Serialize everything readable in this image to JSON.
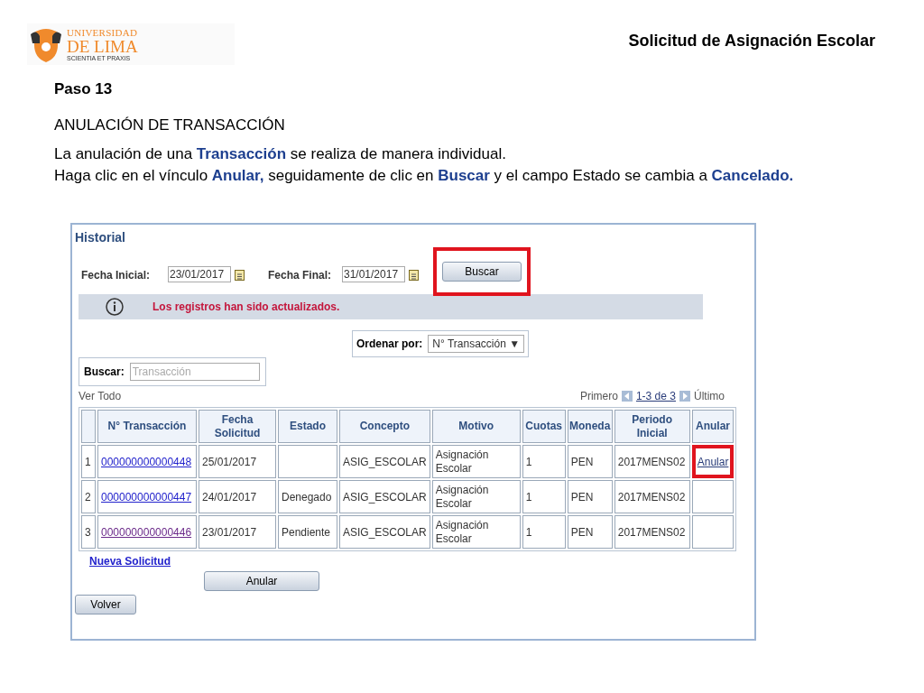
{
  "logo": {
    "line_1": "UNIVERSIDAD",
    "line_2": "DE LIMA",
    "line_3": "SCIENTIA ET PRAXIS"
  },
  "header_title": "Solicitud de Asignación Escolar",
  "step": "Paso 13",
  "section_title": "ANULACIÓN DE TRANSACCIÓN",
  "paragraphs": [
    "La anulación de una **Transacción** se realiza de manera individual.",
    "Haga clic en el vínculo **Anular,**  seguidamente de clic en **Buscar** y el campo Estado se cambia a **Cancelado.**"
  ],
  "screenshot": {
    "title": "Historial",
    "fecha_inicial": {
      "label": "Fecha Inicial:",
      "value": "23/01/2017"
    },
    "fecha_final": {
      "label": "Fecha Final:",
      "value": "31/01/2017"
    },
    "search_button": {
      "label": "Buscar",
      "highlighted": true
    },
    "message": "Los registros han sido actualizados.",
    "sort": {
      "label": "Ordenar por:",
      "value": "N° Transacción",
      "arrow": "▼"
    },
    "search": {
      "label": "Buscar:",
      "placeholder": "Transacción"
    },
    "view_all": "Ver Todo",
    "pager": {
      "first": "Primero",
      "range": "1-3 de 3",
      "last": "Último"
    },
    "table": {
      "columns": [
        "N° Transacción",
        "Fecha Solicitud",
        "Estado",
        "Concepto",
        "Motivo",
        "Cuotas",
        "Moneda",
        "Periodo Inicial",
        "Anular"
      ],
      "rows": [
        {
          "index": "1",
          "transaction": "000000000000448",
          "visited": false,
          "date": "25/01/2017",
          "status": "",
          "concept": "ASIG_ESCOLAR",
          "reason": "Asignación Escolar",
          "installments": "1",
          "currency": "PEN",
          "period": "2017MENS02",
          "cancel": "Anular",
          "highlighted": true
        },
        {
          "index": "2",
          "transaction": "000000000000447",
          "visited": false,
          "date": "24/01/2017",
          "status": "Denegado",
          "concept": "ASIG_ESCOLAR",
          "reason": "Asignación Escolar",
          "installments": "1",
          "currency": "PEN",
          "period": "2017MENS02",
          "cancel": "",
          "highlighted": false
        },
        {
          "index": "3",
          "transaction": "000000000000446",
          "visited": true,
          "date": "23/01/2017",
          "status": "Pendiente",
          "concept": "ASIG_ESCOLAR",
          "reason": "Asignación Escolar",
          "installments": "1",
          "currency": "PEN",
          "period": "2017MENS02",
          "cancel": "",
          "highlighted": false
        }
      ]
    },
    "new_request": "Nueva Solicitud",
    "cancel_button": "Anular",
    "back_button": "Volver"
  }
}
